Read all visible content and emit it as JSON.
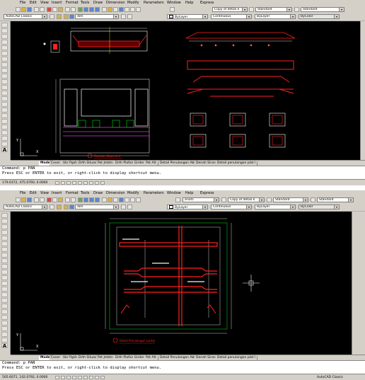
{
  "menus": [
    "File",
    "Edit",
    "View",
    "Insert",
    "Format",
    "Tools",
    "Draw",
    "Dimension",
    "Modify",
    "Parameters",
    "Window",
    "Help",
    "Express"
  ],
  "shot1": {
    "workspace": "AutoCAD Classic",
    "layer": "dim",
    "style1": "Copy of detail k",
    "style2": "Standard",
    "style3": "Standard",
    "color": "ByLayer",
    "linetype": "Continuous",
    "lineweight": "ByLayer",
    "plotstyle": "ByColor",
    "tabs": [
      "Model",
      "Cover",
      "Ukr Pgsh",
      "Drth Situasi",
      "Pot Jmbtn",
      "Drth Plafon Girder",
      "Pot Alt",
      "Detail Penulangan Abt",
      "Denah Siran",
      "Detail penulangan plat l"
    ],
    "cmd_lines": [
      "Command: p PAN",
      "Press ESC or ENTER to exit, or right-click to display shortcut menu."
    ],
    "command_prompt": "Command:",
    "coords": "179.0372, 475.0760, 0.0000",
    "drawing_title_text": "Gambar Abutment"
  },
  "shot2": {
    "workspace": "AutoCAD Classic",
    "layer": "dim",
    "style1": "arial5",
    "style2": "Copy of detail k",
    "style3": "Standard",
    "style4": "Standard",
    "color": "ByLayer",
    "linetype": "Continuous",
    "lineweight": "ByLayer",
    "plotstyle": "ByColor",
    "tabs": [
      "Model",
      "Cover",
      "Ukr Pgsh",
      "Drth Situasi",
      "Pot Jmbtn",
      "Drth Plafon Girder",
      "Pot Alt",
      "Detail Penulangan Abt",
      "Denah Siran",
      "Detail penulangan plat l"
    ],
    "cmd_lines": [
      "Command: p PAN",
      "Press ESC or ENTER to exit, or right-click to display shortcut menu."
    ],
    "command_prompt": "Command:",
    "coords": "505.6071, 142.0792, 0.0000",
    "status_label": "AutoCAD Classic",
    "drawing_title_text": "Detail Penulangan Lantai"
  },
  "colors": {
    "canvas": "#000000",
    "chrome": "#d4d0c8",
    "drawing_red": "#ff2020",
    "drawing_white": "#ffffff",
    "drawing_green": "#00c000",
    "drawing_magenta": "#d040d0"
  }
}
